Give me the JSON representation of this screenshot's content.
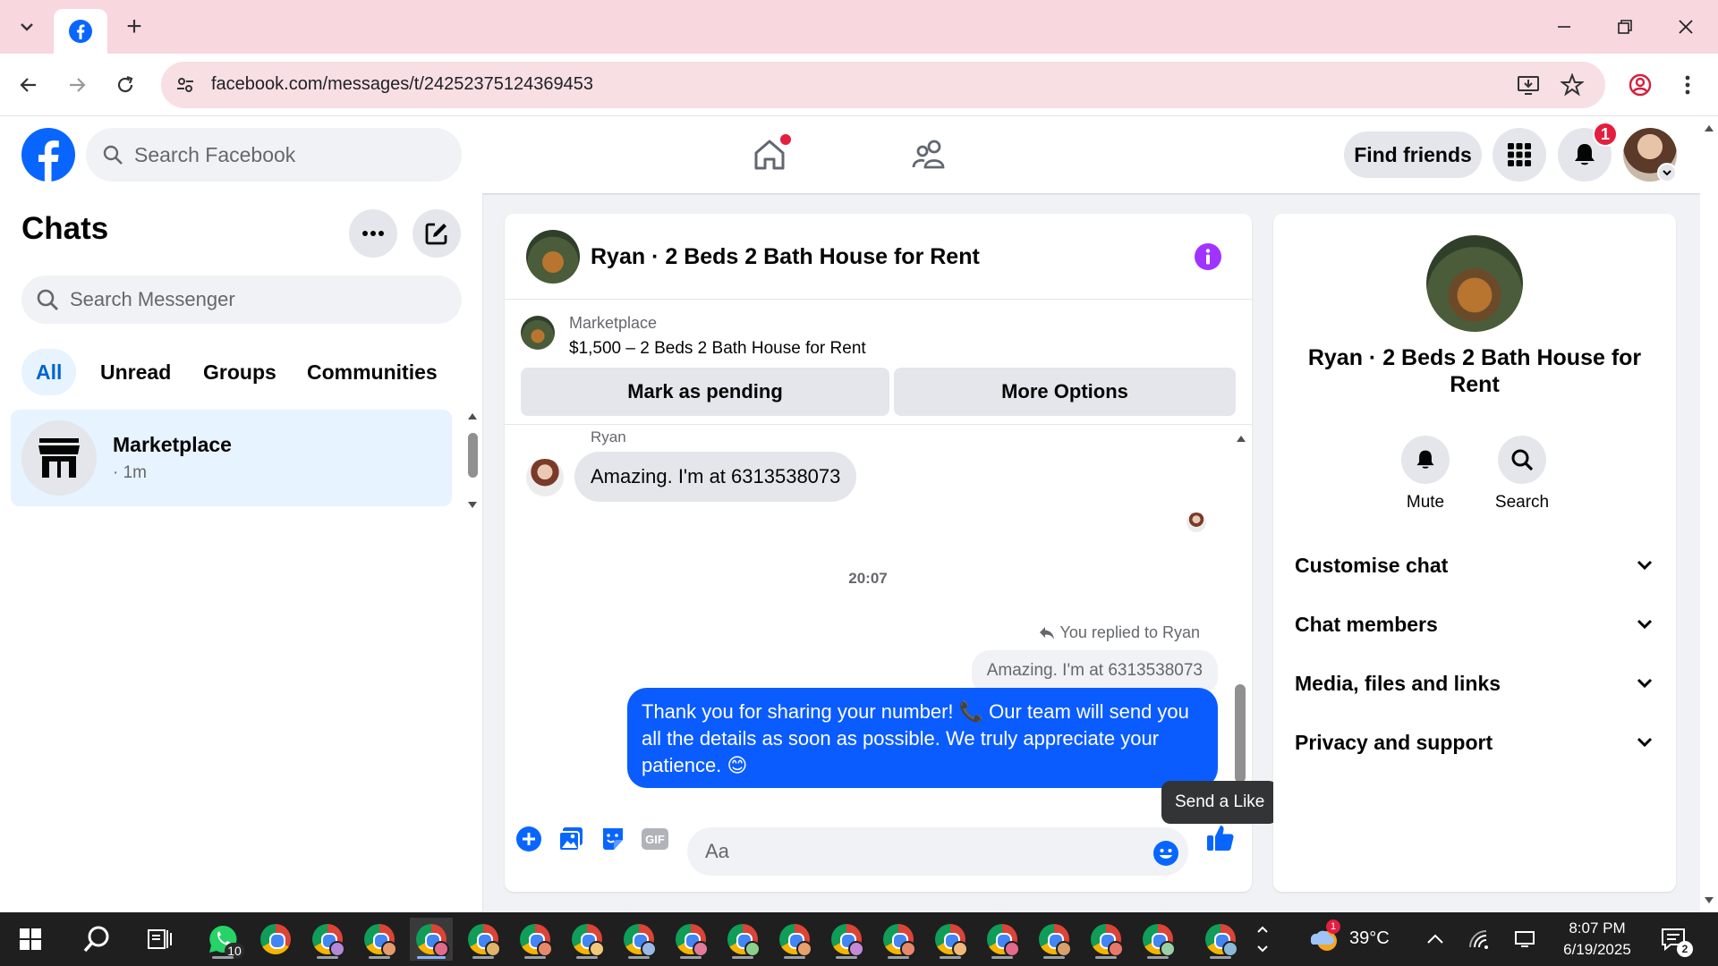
{
  "browser": {
    "url": "facebook.com/messages/t/24252375124369453",
    "new_tab": "+"
  },
  "header": {
    "search_placeholder": "Search Facebook",
    "find_friends": "Find friends",
    "notification_count": "1"
  },
  "chats": {
    "title": "Chats",
    "search_placeholder": "Search Messenger",
    "filters": [
      "All",
      "Unread",
      "Groups",
      "Communities"
    ],
    "active_filter": "All",
    "items": [
      {
        "name": "Marketplace",
        "time": "· 1m"
      }
    ]
  },
  "conversation": {
    "title": "Ryan · 2 Beds 2 Bath House for Rent",
    "marketplace_label": "Marketplace",
    "listing": "$1,500 – 2 Beds 2 Bath House for Rent",
    "mark_pending": "Mark as pending",
    "more_options": "More Options",
    "sender": "Ryan",
    "incoming_message": "Amazing. I'm at 6313538073",
    "timestamp": "20:07",
    "replied_label": "You replied to Ryan",
    "quoted_message": "Amazing. I'm at 6313538073",
    "outgoing_message": "Thank you for sharing your number! 📞 Our team will send you all the details as soon as possible. We truly appreciate your patience. 😊",
    "composer_placeholder": "Aa",
    "tooltip": "Send a Like"
  },
  "info_panel": {
    "name": "Ryan · 2 Beds 2 Bath House for Rent",
    "actions": [
      "Mute",
      "Search"
    ],
    "sections": [
      "Customise chat",
      "Chat members",
      "Media, files and links",
      "Privacy and support"
    ]
  },
  "taskbar": {
    "whatsapp_badge": "10",
    "weather": "39°C",
    "time": "8:07 PM",
    "date": "6/19/2025",
    "notifications": "2",
    "weather_badge": "1"
  },
  "colors": {
    "fb_blue": "#0866ff",
    "bubble_blue": "#0a5cff",
    "messenger_purple": "#a033ff",
    "badge_red": "#e41e3f"
  }
}
